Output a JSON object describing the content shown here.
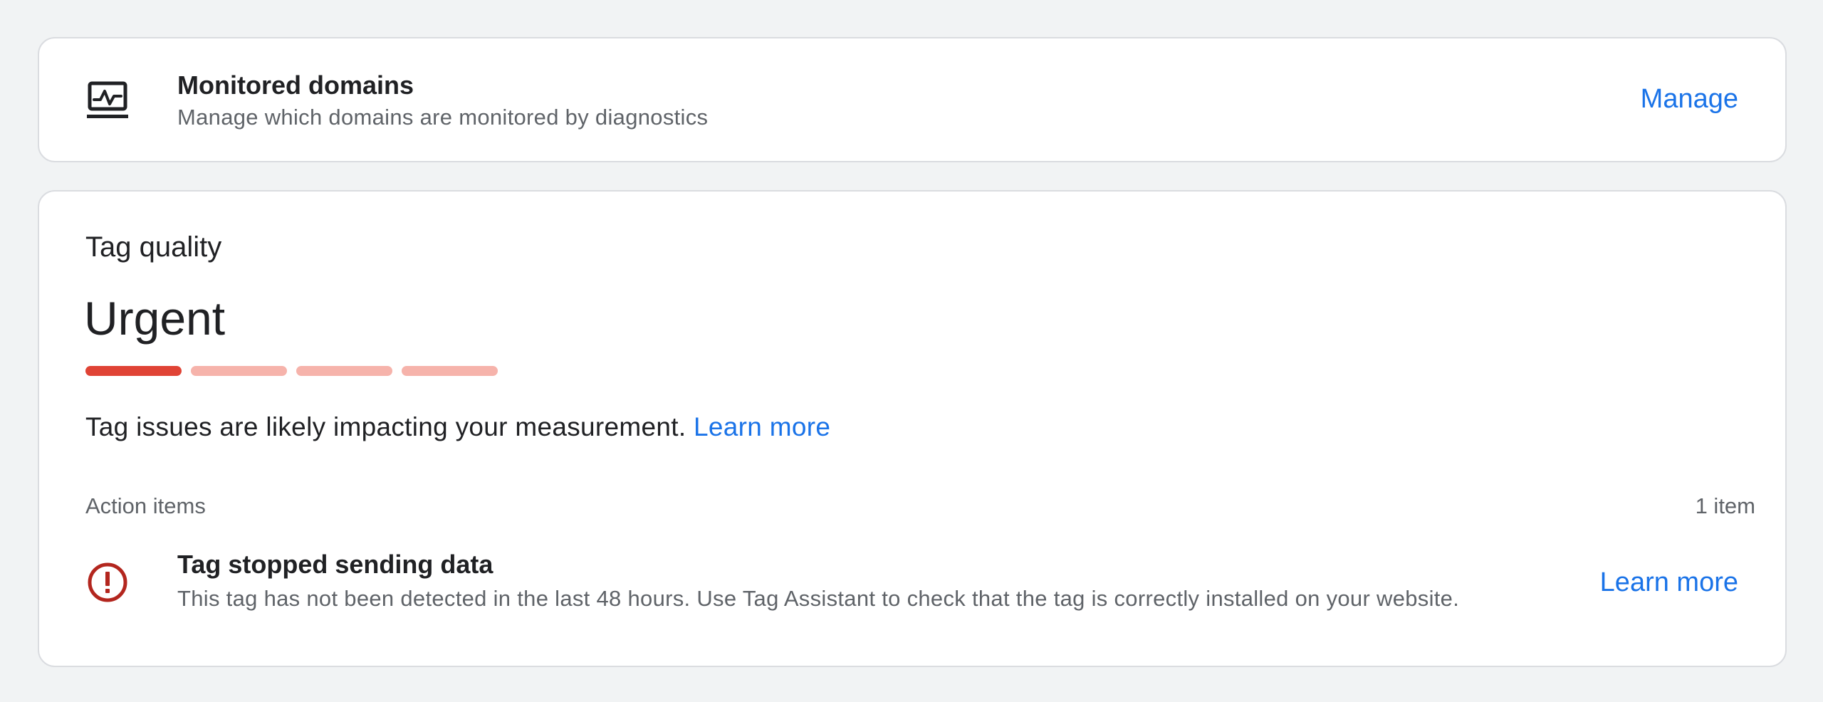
{
  "monitored_domains": {
    "icon": "monitoring-icon",
    "title": "Monitored domains",
    "subtitle": "Manage which domains are monitored by diagnostics",
    "manage_label": "Manage"
  },
  "tag_quality": {
    "label": "Tag quality",
    "status": "Urgent",
    "meter": {
      "segments": 4,
      "active": 1,
      "active_color": "#e04335",
      "inactive_color": "#f6b3ab"
    },
    "message": "Tag issues are likely impacting your measurement.",
    "message_link": "Learn more",
    "action_items_label": "Action items",
    "action_items_count": "1 item",
    "items": [
      {
        "icon": "error-icon",
        "title": "Tag stopped sending data",
        "description": "This tag has not been detected in the last 48 hours. Use Tag Assistant to check that the tag is correctly installed on your website.",
        "action_label": "Learn more"
      }
    ]
  },
  "colors": {
    "accent": "#1a73e8",
    "error": "#b3261e",
    "background": "#f1f3f4"
  }
}
